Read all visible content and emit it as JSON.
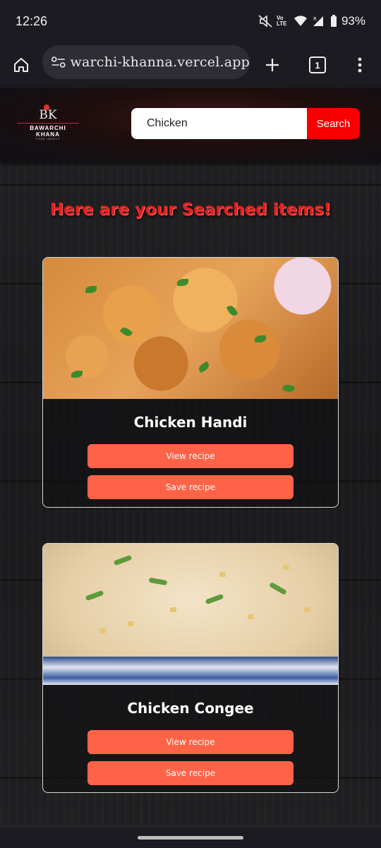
{
  "status_bar": {
    "time": "12:26",
    "battery": "93%",
    "icons": [
      "mute-icon",
      "volte-icon",
      "wifi-icon",
      "signal-icon",
      "battery-icon"
    ],
    "volte_label": "Vo LTE"
  },
  "browser": {
    "url": "warchi-khanna.vercel.app",
    "tab_count": "1"
  },
  "site": {
    "logo_mark": "BK",
    "logo_name": "BAWARCHI KHANA",
    "logo_tagline": "FOOD IMPACT",
    "search": {
      "value": "Chicken",
      "button_label": "Search"
    },
    "results_title": "Here are your Searched items!",
    "recipes": [
      {
        "title": "Chicken Handi",
        "view_label": "View recipe",
        "save_label": "Save recipe"
      },
      {
        "title": "Chicken Congee",
        "view_label": "View recipe",
        "save_label": "Save recipe"
      }
    ]
  },
  "colors": {
    "accent": "#ff6347",
    "search_button": "#f80000",
    "title_red": "#e41e1e"
  }
}
